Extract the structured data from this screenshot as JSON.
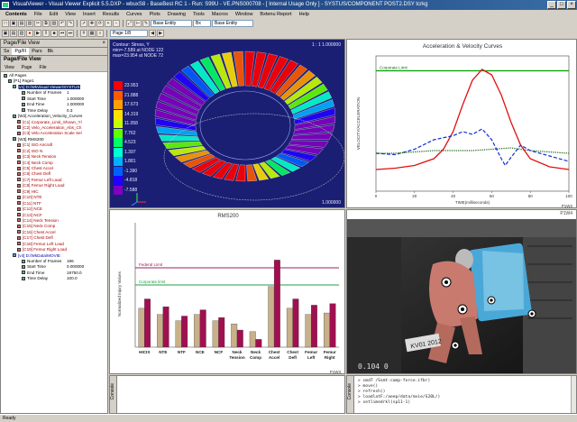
{
  "window": {
    "title": "VisualViewer - Visual Viewer Explicit 5.5.DXP - wbuxS8 - BaseBest RC 1 - Run: S99U - VE.PNS000708 - [ Internal Usage Only ] - SYSTUS/COMPONENT POST2.DSY tcrkg"
  },
  "menu": [
    "Contents",
    "File",
    "Edit",
    "View",
    "Insert",
    "Results",
    "Curves",
    "Plots",
    "Drawing",
    "Tools",
    "Macros",
    "Window",
    "Bxtenu Report",
    "Help"
  ],
  "toolbar2": {
    "combo1": "Base Entity",
    "combo2": "Bx",
    "combo3": "Base Entity",
    "page": "Page 1/8"
  },
  "left_panel": {
    "title": "Page/File View",
    "tabs": [
      "Ss",
      "Pg/Fl",
      "Pars",
      "Bk"
    ],
    "header": "Page/File View",
    "view_options": [
      "View",
      "Page",
      "File"
    ],
    "tree": [
      {
        "label": "All Pages",
        "value": "",
        "cls": ""
      },
      {
        "label": "[P1] Page1",
        "value": "",
        "cls": ""
      },
      {
        "label": "[v1] D:/WkVisual Viewer/SYSTUS",
        "value": "",
        "cls": "sel"
      },
      {
        "label": "Number of Frames",
        "value": "1",
        "cls": ""
      },
      {
        "label": "Start Time",
        "value": "1.000000",
        "cls": ""
      },
      {
        "label": "End Time",
        "value": "1.000000",
        "cls": ""
      },
      {
        "label": "Time Delay",
        "value": "0.3",
        "cls": ""
      },
      {
        "label": "[W2] Acceleration_Velocity_Curves",
        "value": "",
        "cls": ""
      },
      {
        "label": "[C1] Corporate_Limit_Shown_Yl",
        "value": "",
        "cls": "c-red"
      },
      {
        "label": "[C2] Velo_Acceleration_Abs_Ch",
        "value": "",
        "cls": "c-red"
      },
      {
        "label": "[C3] Velo Acceleration Scale Sel",
        "value": "",
        "cls": "c-red"
      },
      {
        "label": "[W3] RMS200",
        "value": "",
        "cls": ""
      },
      {
        "label": "[C1] ISO Aircraft",
        "value": "",
        "cls": "c-red"
      },
      {
        "label": "[C2] ISO N",
        "value": "",
        "cls": "c-red"
      },
      {
        "label": "[C3] Neck Tension",
        "value": "",
        "cls": "c-red"
      },
      {
        "label": "[C4] Neck Comp",
        "value": "",
        "cls": "c-red"
      },
      {
        "label": "[C5] Chest Accel",
        "value": "",
        "cls": "c-red"
      },
      {
        "label": "[C6] Chest Defl",
        "value": "",
        "cls": "c-red"
      },
      {
        "label": "[C7] Femur Left Load",
        "value": "",
        "cls": "c-red"
      },
      {
        "label": "[C8] Femur Right Load",
        "value": "",
        "cls": "c-red"
      },
      {
        "label": "[C9] HIC",
        "value": "",
        "cls": "c-red"
      },
      {
        "label": "[C10] NTE",
        "value": "",
        "cls": "c-red"
      },
      {
        "label": "[C11] NTF",
        "value": "",
        "cls": "c-red"
      },
      {
        "label": "[C12] NCE",
        "value": "",
        "cls": "c-red"
      },
      {
        "label": "[C13] NCF",
        "value": "",
        "cls": "c-red"
      },
      {
        "label": "[C14] Neck Tension",
        "value": "",
        "cls": "c-red"
      },
      {
        "label": "[C15] Neck Comp",
        "value": "",
        "cls": "c-red"
      },
      {
        "label": "[C16] Chest Accel",
        "value": "",
        "cls": "c-red"
      },
      {
        "label": "[C17] Chest Defl",
        "value": "",
        "cls": "c-red"
      },
      {
        "label": "[C18] Femur Left Load",
        "value": "",
        "cls": "c-red"
      },
      {
        "label": "[C19] Femur Right Load",
        "value": "",
        "cls": "c-red"
      },
      {
        "label": "[v4] D:/WkData/MOVIE",
        "value": "",
        "cls": "c-blue"
      },
      {
        "label": "Number of Frames",
        "value": "196",
        "cls": ""
      },
      {
        "label": "Start Time",
        "value": "0.000000",
        "cls": ""
      },
      {
        "label": "End Time",
        "value": "19750.0",
        "cls": ""
      },
      {
        "label": "Time Delay",
        "value": "100.0",
        "cls": ""
      }
    ]
  },
  "view3d": {
    "label1": "Contour: Stress, Y",
    "label2": "min=-7.589 at NODE 122",
    "label3": "max=23.954 at NODE 72",
    "frame": "1 : 1 1.000000",
    "scale_label": "1.000000",
    "legend": [
      "23.953",
      "21.888",
      "17.673",
      "14.319",
      "11.058",
      "7.762",
      "4.523",
      "1.397",
      "1.881",
      "-1.390",
      "-4.818",
      "-7.588"
    ],
    "colors": {
      "bg": "#1b1f73"
    }
  },
  "chart_panel": {
    "title": "Acceleration & Velocity Curves",
    "corner": "P1W2"
  },
  "bar_panel": {
    "title": "RMS200",
    "corner": "P1W3"
  },
  "movie_panel": {
    "title": "P1W4",
    "counter": "0.104 0"
  },
  "console": {
    "label": "Console",
    "lines": [
      "> cmd7 /Ssmt-comp-force.ifbr)",
      "> move()",
      "> refresh()",
      "> loadlatF:/aeep/data/mvie/S20L/)",
      "> setlimedrkl(sp11-1)"
    ]
  },
  "console2": {
    "label": "Console"
  },
  "status": "Ready",
  "chart_data": [
    {
      "type": "line",
      "title": "Acceleration & Velocity Curves",
      "xlabel": "TIME(milliseconds)",
      "ylabel": "VELOCITY/ACCELERATION",
      "xlim": [
        0,
        100
      ],
      "ylim": [
        -16,
        84
      ],
      "x_ticks": [
        0,
        20,
        40,
        60,
        80,
        100
      ],
      "annotation": "Corporate Limit",
      "series": [
        {
          "color": "#00a000",
          "style": "solid",
          "x": [
            0,
            100
          ],
          "y": [
            73,
            73
          ]
        },
        {
          "color": "#e01010",
          "style": "solid",
          "x": [
            0,
            10,
            20,
            30,
            35,
            40,
            45,
            50,
            55,
            60,
            65,
            70,
            75,
            80,
            90,
            100
          ],
          "y": [
            0,
            1,
            3,
            8,
            15,
            28,
            48,
            66,
            74,
            70,
            55,
            35,
            18,
            8,
            2,
            0
          ]
        },
        {
          "color": "#1030d0",
          "style": "dash",
          "x": [
            0,
            10,
            20,
            30,
            40,
            45,
            50,
            55,
            60,
            65,
            67,
            70,
            75,
            80,
            90,
            100
          ],
          "y": [
            12,
            11,
            15,
            22,
            25,
            28,
            26,
            30,
            22,
            8,
            3,
            9,
            18,
            14,
            10,
            6
          ]
        },
        {
          "color": "#106010",
          "style": "dot",
          "x": [
            0,
            10,
            20,
            30,
            40,
            50,
            60,
            70,
            80,
            90,
            100
          ],
          "y": [
            12,
            12,
            13,
            14,
            14,
            14,
            15,
            16,
            14,
            13,
            12
          ]
        }
      ]
    },
    {
      "type": "bar",
      "title": "RMS200",
      "ylabel": "Normalized Injury Values",
      "categories": [
        "HICIS",
        "NTE",
        "NTF",
        "NCE",
        "NCF",
        "Neck Tension",
        "Neck Comp",
        "Chest Accel",
        "Chest Defl",
        "Femur Left",
        "Femur Right"
      ],
      "ylim": [
        0,
        1.6
      ],
      "limits": [
        {
          "label": "Federal Limit",
          "value": 1.02,
          "color": "#9a2060"
        },
        {
          "label": "Corporate limit",
          "value": 0.8,
          "color": "#20a040"
        }
      ],
      "series": [
        {
          "color": "#c8b08a",
          "values": [
            0.5,
            0.42,
            0.34,
            0.42,
            0.34,
            0.3,
            0.2,
            0.78,
            0.5,
            0.42,
            0.44
          ]
        },
        {
          "color": "#a01050",
          "values": [
            0.62,
            0.52,
            0.4,
            0.48,
            0.38,
            0.22,
            0.1,
            1.12,
            0.62,
            0.54,
            0.56
          ]
        }
      ]
    }
  ]
}
